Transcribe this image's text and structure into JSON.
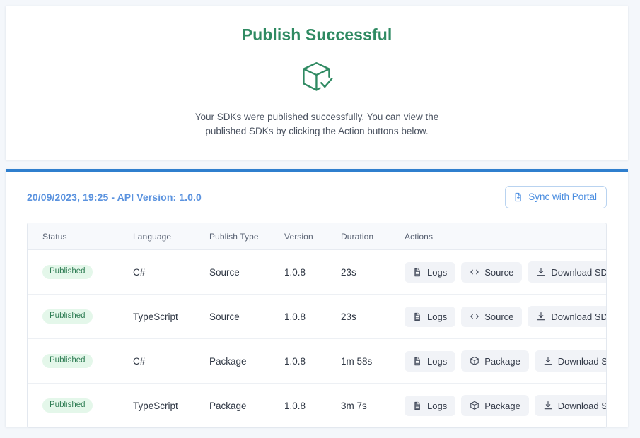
{
  "colors": {
    "page_background": "#f4f7fb",
    "success_green": "#2f8a62",
    "accent_blue": "#2f7fce",
    "meta_blue": "#5b93df",
    "badge_bg": "#e4f7ea",
    "badge_text": "#2f7d54",
    "action_btn_bg": "#f1f3f7"
  },
  "success_panel": {
    "title": "Publish Successful",
    "icon": "package-check-icon",
    "description": "Your SDKs were published successfully. You can view the published SDKs by clicking the Action buttons below."
  },
  "results_panel": {
    "meta": "20/09/2023, 19:25 - API Version: 1.0.0",
    "sync_button": {
      "label": "Sync with Portal",
      "icon": "file-sync-icon"
    },
    "table": {
      "columns": [
        "Status",
        "Language",
        "Publish Type",
        "Version",
        "Duration",
        "Actions"
      ],
      "rows": [
        {
          "status": "Published",
          "language": "C#",
          "publish_type": "Source",
          "version": "1.0.8",
          "duration": "23s",
          "actions": [
            {
              "label": "Logs",
              "icon": "file-text-icon"
            },
            {
              "label": "Source",
              "icon": "code-brackets-icon"
            },
            {
              "label": "Download SDK",
              "icon": "download-icon"
            }
          ]
        },
        {
          "status": "Published",
          "language": "TypeScript",
          "publish_type": "Source",
          "version": "1.0.8",
          "duration": "23s",
          "actions": [
            {
              "label": "Logs",
              "icon": "file-text-icon"
            },
            {
              "label": "Source",
              "icon": "code-brackets-icon"
            },
            {
              "label": "Download SDK",
              "icon": "download-icon"
            }
          ]
        },
        {
          "status": "Published",
          "language": "C#",
          "publish_type": "Package",
          "version": "1.0.8",
          "duration": "1m 58s",
          "actions": [
            {
              "label": "Logs",
              "icon": "file-text-icon"
            },
            {
              "label": "Package",
              "icon": "package-icon"
            },
            {
              "label": "Download SDK",
              "icon": "download-icon"
            }
          ]
        },
        {
          "status": "Published",
          "language": "TypeScript",
          "publish_type": "Package",
          "version": "1.0.8",
          "duration": "3m 7s",
          "actions": [
            {
              "label": "Logs",
              "icon": "file-text-icon"
            },
            {
              "label": "Package",
              "icon": "package-icon"
            },
            {
              "label": "Download SDK",
              "icon": "download-icon"
            }
          ]
        }
      ]
    }
  }
}
